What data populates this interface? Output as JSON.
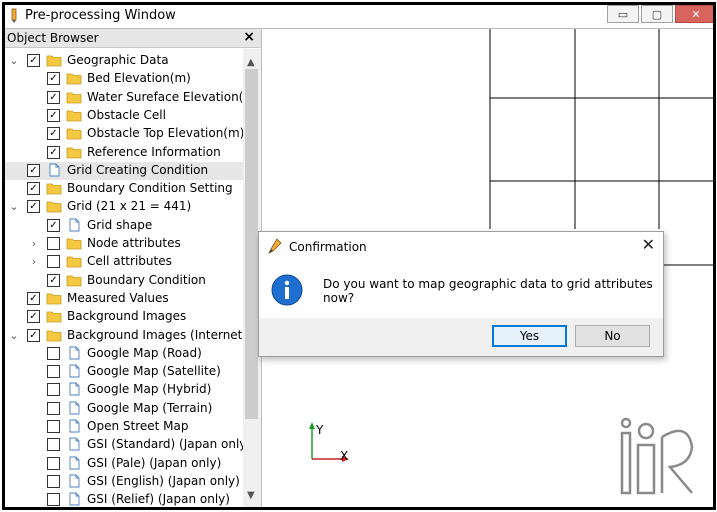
{
  "window": {
    "title": "Pre-processing Window",
    "min_glyph": "▭",
    "max_glyph": "▢",
    "close_glyph": "✕"
  },
  "browser": {
    "title": "Object Browser",
    "close_glyph": "×",
    "scroll_up": "▲",
    "scroll_down": "▼",
    "items": [
      {
        "label": "Geographic Data",
        "level": 0,
        "expander": "open",
        "checked": true,
        "icon": "folder-icon"
      },
      {
        "label": "Bed Elevation(m)",
        "level": 1,
        "expander": "none",
        "checked": true,
        "icon": "folder-icon"
      },
      {
        "label": "Water Sureface Elevation(...",
        "level": 1,
        "expander": "none",
        "checked": true,
        "icon": "folder-icon"
      },
      {
        "label": "Obstacle Cell",
        "level": 1,
        "expander": "none",
        "checked": true,
        "icon": "folder-icon"
      },
      {
        "label": "Obstacle Top Elevation(m)",
        "level": 1,
        "expander": "none",
        "checked": true,
        "icon": "folder-icon"
      },
      {
        "label": "Reference Information",
        "level": 1,
        "expander": "none",
        "checked": true,
        "icon": "folder-icon"
      },
      {
        "label": "Grid Creating Condition",
        "level": 0,
        "expander": "none",
        "checked": true,
        "icon": "document-icon",
        "selected": true
      },
      {
        "label": "Boundary Condition Setting",
        "level": 0,
        "expander": "none",
        "checked": true,
        "icon": "folder-icon"
      },
      {
        "label": "Grid (21 x 21 = 441)",
        "level": 0,
        "expander": "open",
        "checked": true,
        "icon": "folder-icon"
      },
      {
        "label": "Grid shape",
        "level": 1,
        "expander": "none",
        "checked": true,
        "icon": "document-icon"
      },
      {
        "label": "Node attributes",
        "level": 1,
        "expander": "closed",
        "checked": false,
        "icon": "folder-icon"
      },
      {
        "label": "Cell attributes",
        "level": 1,
        "expander": "closed",
        "checked": false,
        "icon": "folder-icon"
      },
      {
        "label": "Boundary Condition",
        "level": 1,
        "expander": "none",
        "checked": true,
        "icon": "folder-icon"
      },
      {
        "label": "Measured Values",
        "level": 0,
        "expander": "none",
        "checked": true,
        "icon": "folder-icon"
      },
      {
        "label": "Background Images",
        "level": 0,
        "expander": "none",
        "checked": true,
        "icon": "folder-icon"
      },
      {
        "label": "Background Images (Internet)",
        "level": 0,
        "expander": "open",
        "checked": true,
        "icon": "folder-icon"
      },
      {
        "label": "Google Map (Road)",
        "level": 1,
        "expander": "none",
        "checked": false,
        "icon": "document-icon"
      },
      {
        "label": "Google Map (Satellite)",
        "level": 1,
        "expander": "none",
        "checked": false,
        "icon": "document-icon"
      },
      {
        "label": "Google Map (Hybrid)",
        "level": 1,
        "expander": "none",
        "checked": false,
        "icon": "document-icon"
      },
      {
        "label": "Google Map (Terrain)",
        "level": 1,
        "expander": "none",
        "checked": false,
        "icon": "document-icon"
      },
      {
        "label": "Open Street Map",
        "level": 1,
        "expander": "none",
        "checked": false,
        "icon": "document-icon"
      },
      {
        "label": "GSI (Standard) (Japan only)",
        "level": 1,
        "expander": "none",
        "checked": false,
        "icon": "document-icon"
      },
      {
        "label": "GSI (Pale) (Japan only)",
        "level": 1,
        "expander": "none",
        "checked": false,
        "icon": "document-icon"
      },
      {
        "label": "GSI (English) (Japan only)",
        "level": 1,
        "expander": "none",
        "checked": false,
        "icon": "document-icon"
      },
      {
        "label": "GSI (Relief) (Japan only)",
        "level": 1,
        "expander": "none",
        "checked": false,
        "icon": "document-icon"
      }
    ]
  },
  "canvas": {
    "axis_y_label": "Y",
    "axis_x_label": "X",
    "logo": "iRIC"
  },
  "dialog": {
    "title": "Confirmation",
    "close_glyph": "✕",
    "message": "Do you want to map geographic data to grid attributes now?",
    "yes_label": "Yes",
    "no_label": "No"
  },
  "colors": {
    "folder": "#f5c842",
    "folder_edge": "#c99a1c",
    "selection": "#e6e6e6",
    "info_blue": "#1f6fd1",
    "axis_green": "#1a9b2b",
    "axis_red": "#cc2222",
    "close_red": "#d8645e"
  }
}
